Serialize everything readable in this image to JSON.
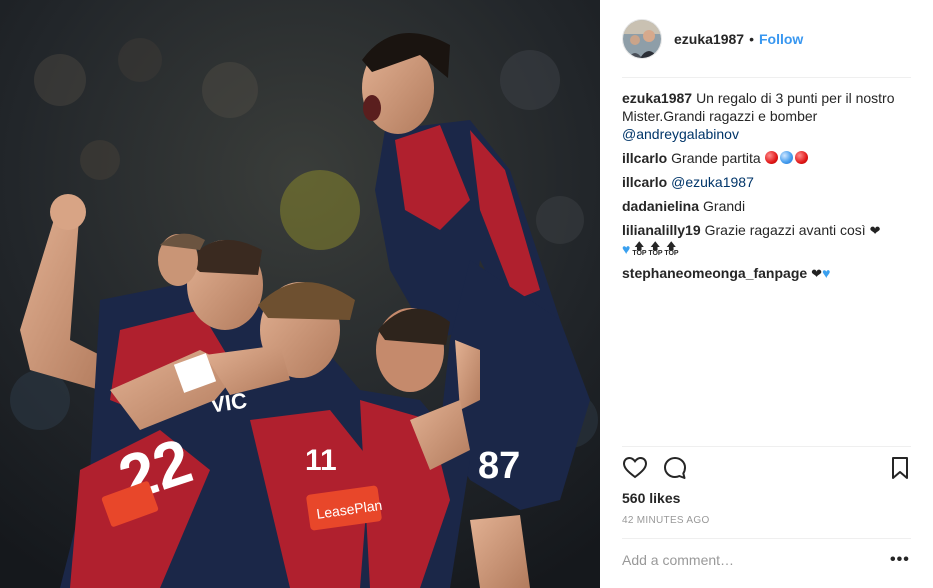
{
  "post": {
    "username": "ezuka1987",
    "separator": "•",
    "follow_label": "Follow",
    "caption": {
      "user": "ezuka1987",
      "text": "Un regalo di 3 punti per il nostro Mister.Grandi ragazzi e bomber",
      "mention": "@andreygalabinov"
    },
    "comments": [
      {
        "user": "illcarlo",
        "text": "Grande partita"
      },
      {
        "user": "illcarlo",
        "mention": "@ezuka1987"
      },
      {
        "user": "dadanielina",
        "text": "Grandi"
      },
      {
        "user": "lilianalilly19",
        "text": "Grazie ragazzi avanti così"
      },
      {
        "user": "stephaneomeonga_fanpage"
      }
    ],
    "top_label": "TOP",
    "likes": "560 likes",
    "time_ago": "42 minutes ago",
    "comment_placeholder": "Add a comment…",
    "more_label": "•••"
  },
  "photo": {
    "shirt_numbers": [
      "22",
      "87",
      "11"
    ],
    "sponsor": "LeasePlan",
    "name_on_shirt": "VIC"
  },
  "icons": {
    "like": "heart-outline-icon",
    "comment": "speech-bubble-icon",
    "save": "bookmark-icon"
  },
  "colors": {
    "link_blue": "#3897f0",
    "mention_blue": "#003569",
    "genoa_red": "#b0202e",
    "genoa_navy": "#1b2748"
  }
}
